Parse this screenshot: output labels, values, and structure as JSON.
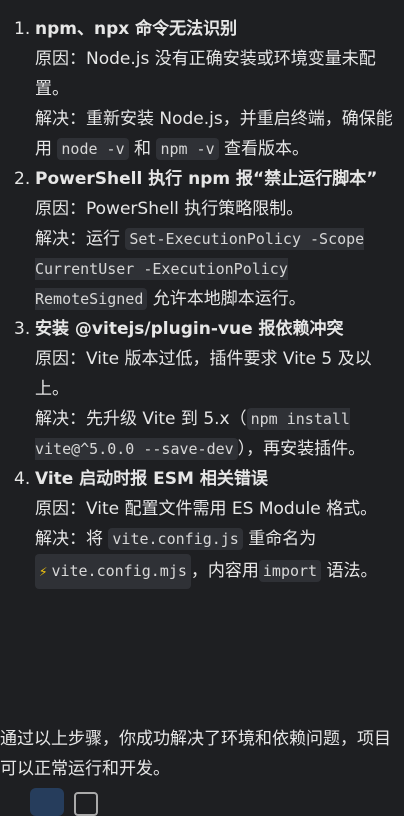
{
  "items": [
    {
      "num": "1.",
      "title": "npm、npx 命令无法识别",
      "cause": "原因：Node.js 没有正确安装或环境变量未配置。",
      "fix_prefix": "解决：重新安装 Node.js，并重启终端，确保能用",
      "code1": "node -v",
      "mid": "和",
      "code2": "npm -v",
      "fix_suffix": "查看版本。"
    },
    {
      "num": "2.",
      "title": "PowerShell 执行 npm 报“禁止运行脚本”",
      "cause": "原因：PowerShell 执行策略限制。",
      "fix_prefix": "解决：运行",
      "code1": "Set-ExecutionPolicy -Scope CurrentUser -ExecutionPolicy RemoteSigned",
      "fix_suffix": "允许本地脚本运行。"
    },
    {
      "num": "3.",
      "title": "安装 @vitejs/plugin-vue 报依赖冲突",
      "cause": "原因：Vite 版本过低，插件要求 Vite 5 及以上。",
      "fix_prefix": "解决：先升级 Vite 到 5.x（",
      "code1": "npm install vite@^5.0.0 --save-dev",
      "fix_suffix": "），再安装插件。"
    },
    {
      "num": "4.",
      "title": "Vite 启动时报 ESM 相关错误",
      "cause": "原因：Vite 配置文件需用 ES Module 格式。",
      "fix_prefix": "解决：将",
      "code1": "vite.config.js",
      "mid": "重命名为",
      "file": "vite.config.mjs",
      "mid2": "，内容用",
      "code2": "import",
      "fix_suffix": "语法。"
    }
  ],
  "summary": "通过以上步骤，你成功解决了环境和依赖问题，项目可以正常运行和开发。"
}
